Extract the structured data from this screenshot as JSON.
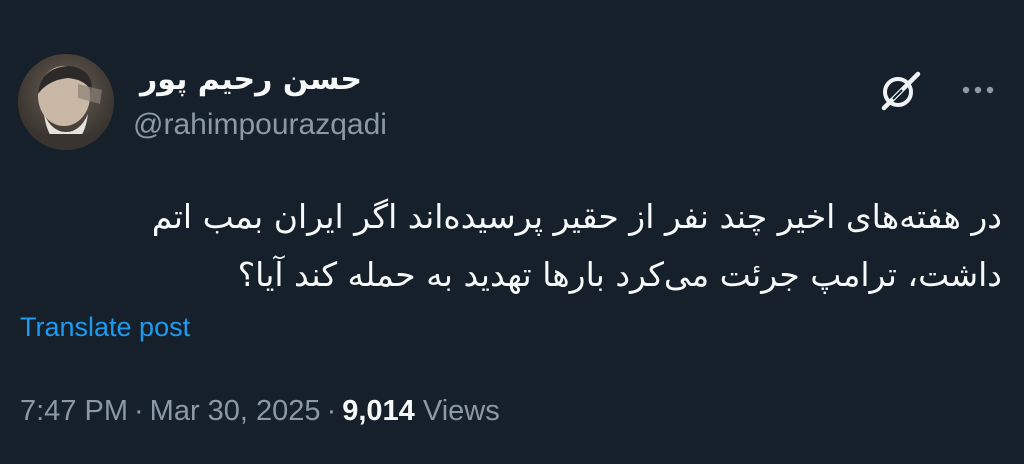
{
  "author": {
    "display_name": "حسن رحیم پور",
    "handle": "@rahimpourazqadi"
  },
  "tweet": {
    "lines": [
      "در هفته‌های اخیر چند نفر از حقیر پرسیده‌اند اگر ایران بمب اتم",
      "داشت، ترامپ جرئت می‌کرد بارها تهدید به حمله کند آیا؟"
    ],
    "translate_label": "Translate post"
  },
  "meta": {
    "time": "7:47 PM",
    "separator": "·",
    "date": "Mar 30, 2025",
    "views_count": "9,014",
    "views_label": "Views"
  },
  "icons": {
    "grok": "grok-icon",
    "more": "more-icon"
  },
  "colors": {
    "background": "#15202b",
    "text": "#f7f9f9",
    "secondary": "#8b98a5",
    "link": "#1d9bf0"
  }
}
